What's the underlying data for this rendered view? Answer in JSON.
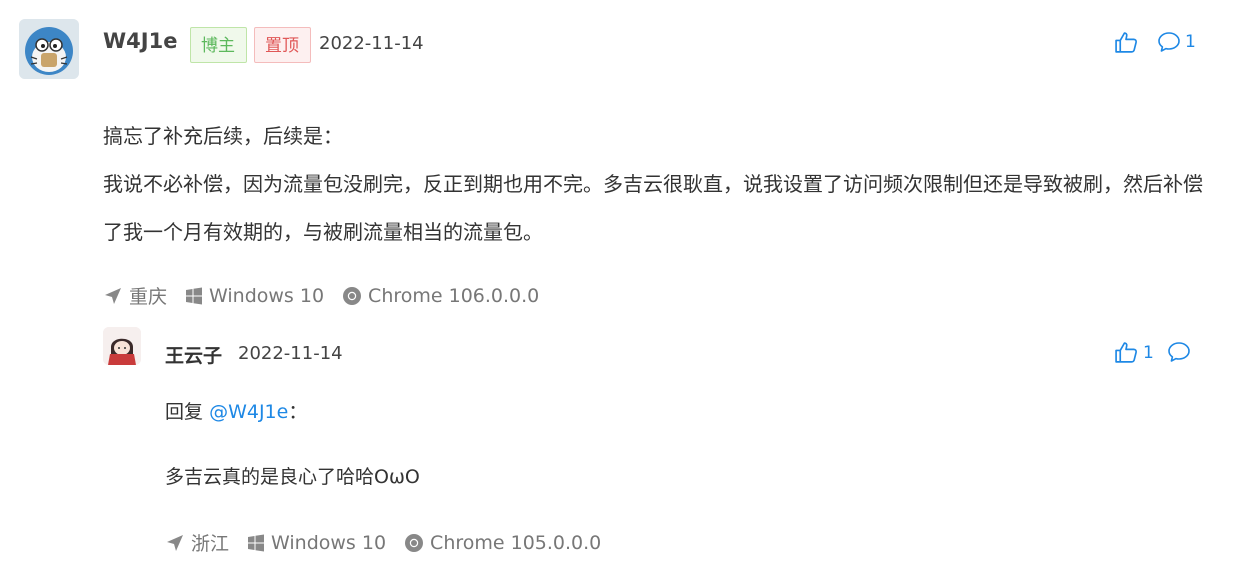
{
  "comment": {
    "author": "W4J1e",
    "badge_author": "博主",
    "badge_pinned": "置顶",
    "date": "2022-11-14",
    "reply_count": "1",
    "paragraphs": [
      "搞忘了补充后续，后续是：",
      "我说不必补偿，因为流量包没刷完，反正到期也用不完。多吉云很耿直，说我设置了访问频次限制但还是导致被刷，然后补偿了我一个月有效期的，与被刷流量相当的流量包。"
    ],
    "meta": {
      "location": "重庆",
      "os": "Windows 10",
      "browser": "Chrome 106.0.0.0"
    }
  },
  "reply": {
    "author": "王云子",
    "date": "2022-11-14",
    "like_count": "1",
    "reply_prefix": "回复",
    "mention": "@W4J1e",
    "colon": "：",
    "text": "多吉云真的是良心了哈哈OωO",
    "meta": {
      "location": "浙江",
      "os": "Windows 10",
      "browser": "Chrome 105.0.0.0"
    }
  },
  "colors": {
    "accent": "#1e88e5",
    "meta_gray": "#777777",
    "badge_green": "#5cb85c",
    "badge_red": "#e05757"
  },
  "icons": [
    "thumbs-up-icon",
    "comment-bubble-icon",
    "location-arrow-icon",
    "windows-icon",
    "chrome-icon"
  ]
}
